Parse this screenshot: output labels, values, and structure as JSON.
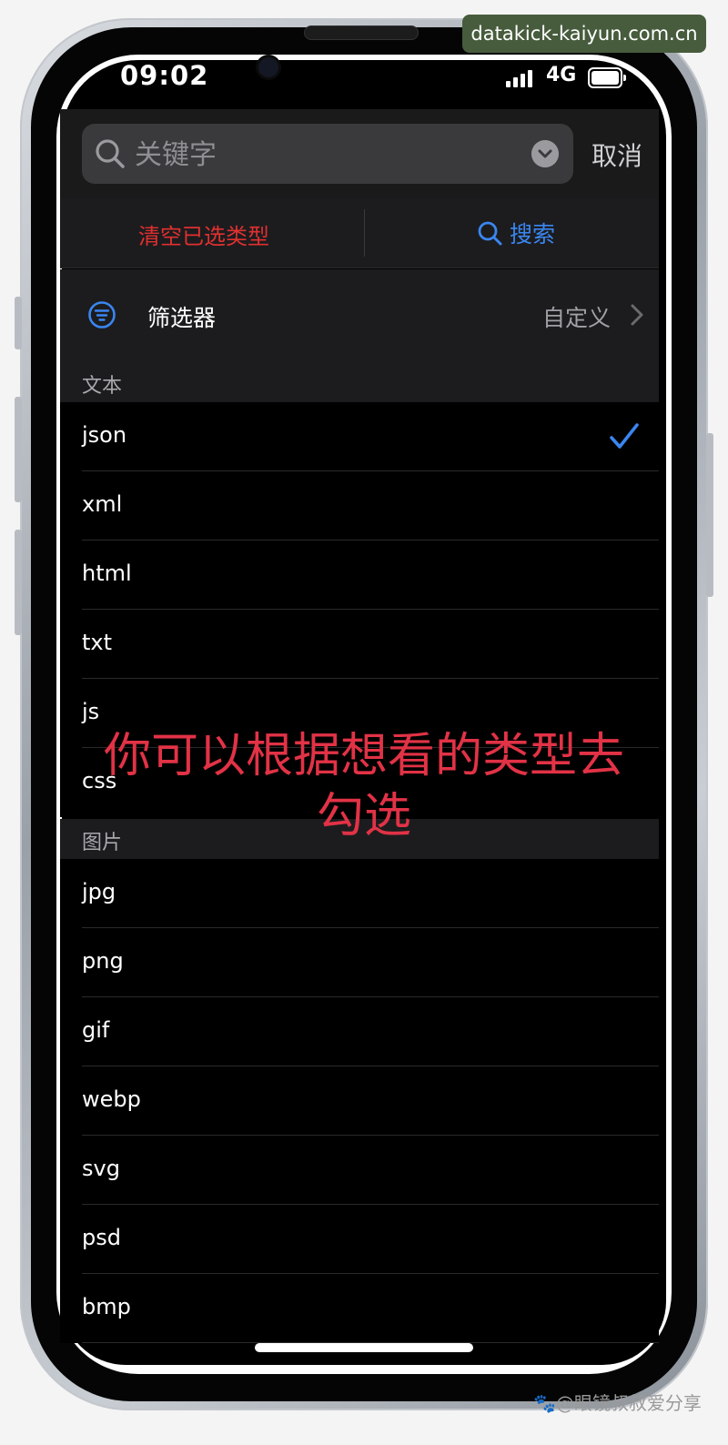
{
  "watermark": {
    "url": "datakick-kaiyun.com.cn",
    "credit": "🐾@眼镜叔叔爱分享"
  },
  "status_bar": {
    "time": "09:02",
    "network": "4G"
  },
  "search": {
    "placeholder": "关键字",
    "cancel_label": "取消"
  },
  "actions": {
    "clear_label": "清空已选类型",
    "search_label": "搜索"
  },
  "filter": {
    "label": "筛选器",
    "value": "自定义"
  },
  "sections": [
    {
      "title": "文本",
      "items": [
        {
          "label": "json",
          "checked": true
        },
        {
          "label": "xml",
          "checked": false
        },
        {
          "label": "html",
          "checked": false
        },
        {
          "label": "txt",
          "checked": false
        },
        {
          "label": "js",
          "checked": false
        },
        {
          "label": "css",
          "checked": false
        }
      ]
    },
    {
      "title": "图片",
      "items": [
        {
          "label": "jpg",
          "checked": false
        },
        {
          "label": "png",
          "checked": false
        },
        {
          "label": "gif",
          "checked": false
        },
        {
          "label": "webp",
          "checked": false
        },
        {
          "label": "svg",
          "checked": false
        },
        {
          "label": "psd",
          "checked": false
        },
        {
          "label": "bmp",
          "checked": false
        }
      ]
    }
  ],
  "overlay": {
    "line1": "你可以根据想看的类型去",
    "line2": "勾选"
  },
  "colors": {
    "accent": "#3a86f0",
    "danger": "#e03030",
    "overlay": "#e23246",
    "url_badge": "#475c3d"
  }
}
